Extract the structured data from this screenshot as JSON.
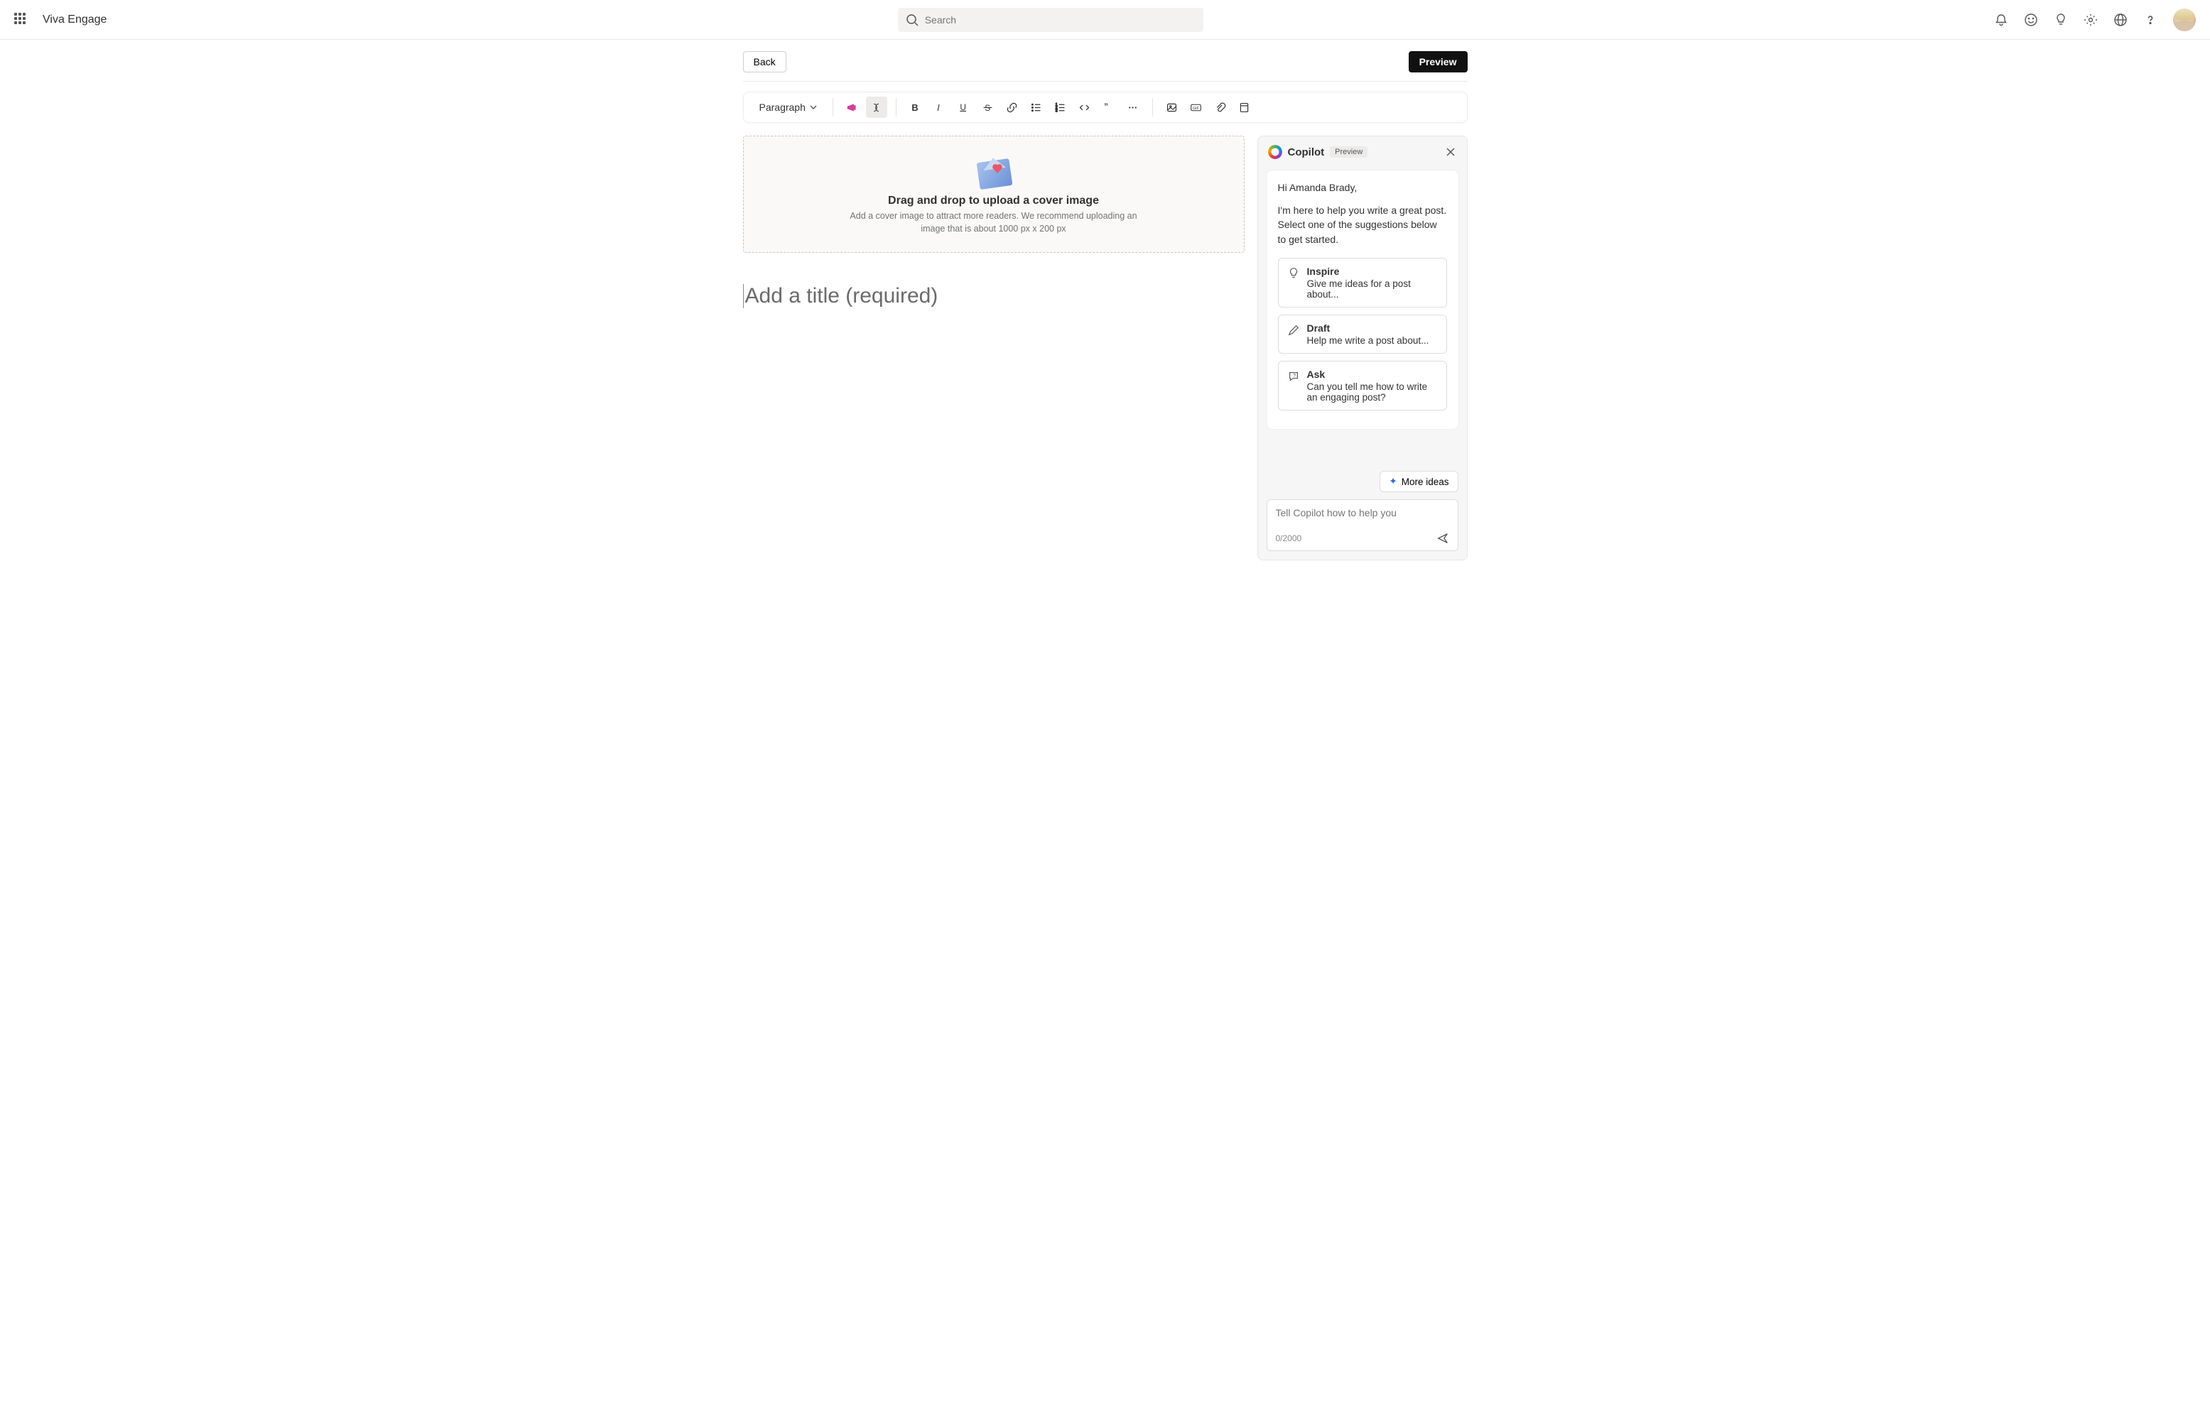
{
  "header": {
    "app_title": "Viva Engage",
    "search_placeholder": "Search"
  },
  "actionbar": {
    "back_label": "Back",
    "preview_label": "Preview"
  },
  "toolbar": {
    "style_selector": "Paragraph"
  },
  "cover": {
    "heading": "Drag and drop to upload a cover image",
    "subtext": "Add a cover image to attract more readers. We recommend uploading an image that is about 1000 px x 200 px"
  },
  "editor": {
    "title_placeholder": "Add a title (required)"
  },
  "copilot": {
    "title": "Copilot",
    "badge": "Preview",
    "greeting": "Hi Amanda Brady,",
    "intro": "I'm here to help you write a great post. Select one of the suggestions below to get started.",
    "suggestions": [
      {
        "title": "Inspire",
        "desc": "Give me ideas for a post about..."
      },
      {
        "title": "Draft",
        "desc": "Help me write a post about..."
      },
      {
        "title": "Ask",
        "desc": "Can you tell me how to write an engaging post?"
      }
    ],
    "more_ideas_label": "More ideas",
    "input_placeholder": "Tell Copilot how to help you",
    "char_counter": "0/2000"
  }
}
